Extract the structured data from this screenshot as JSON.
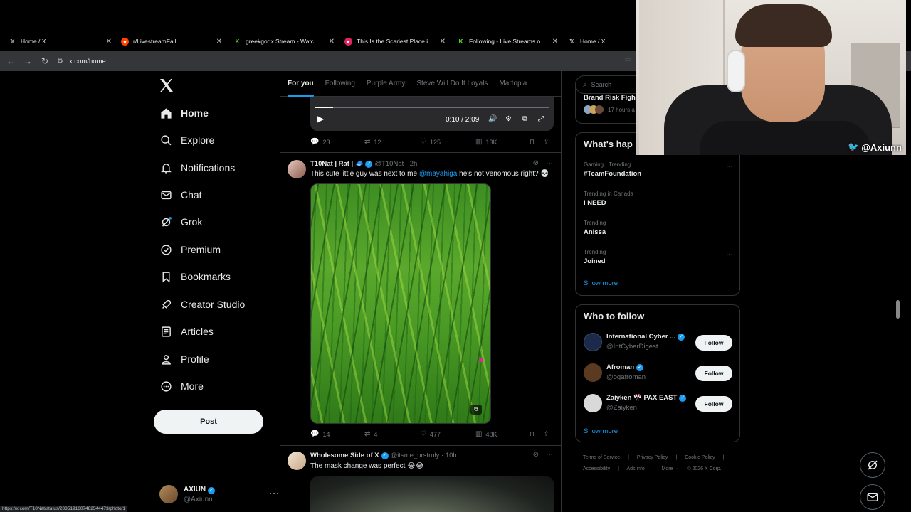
{
  "browser": {
    "tabs": [
      {
        "title": "Home / X",
        "favicon": "x-logo-icon"
      },
      {
        "title": "r/LivestreamFail",
        "favicon": "reddit-icon"
      },
      {
        "title": "greekgodx Stream - Watch Live",
        "favicon": "kick-icon"
      },
      {
        "title": "This Is the Scariest Place in The",
        "favicon": "youtube-icon"
      },
      {
        "title": "Following - Live Streams on Kic",
        "favicon": "kick-icon"
      },
      {
        "title": "Home / X",
        "favicon": "x-logo-icon"
      }
    ],
    "url": "x.com/home",
    "status_url": "https://x.com/T10Nat/status/2035191607482544473/photo/1"
  },
  "nav": {
    "items": [
      {
        "label": "Home",
        "icon": "home-icon",
        "active": true
      },
      {
        "label": "Explore",
        "icon": "search-icon"
      },
      {
        "label": "Notifications",
        "icon": "bell-icon"
      },
      {
        "label": "Chat",
        "icon": "mail-icon"
      },
      {
        "label": "Grok",
        "icon": "grok-icon"
      },
      {
        "label": "Premium",
        "icon": "premium-icon"
      },
      {
        "label": "Bookmarks",
        "icon": "bookmark-icon"
      },
      {
        "label": "Creator Studio",
        "icon": "rocket-icon"
      },
      {
        "label": "Articles",
        "icon": "article-icon"
      },
      {
        "label": "Profile",
        "icon": "person-icon"
      },
      {
        "label": "More",
        "icon": "more-circle-icon"
      }
    ],
    "post_label": "Post",
    "account": {
      "name": "AXIUN",
      "handle": "@Axiunn"
    }
  },
  "timeline": {
    "tabs": [
      "For you",
      "Following",
      "Purple Army",
      "Steve Will Do It Loyals",
      "Martopia"
    ],
    "video": {
      "time": "0:10 / 2:09",
      "progress": 0.08
    },
    "prev_stats": {
      "replies": "23",
      "reposts": "12",
      "likes": "125",
      "views": "13K"
    },
    "post1": {
      "name": "T10Nat | Rat |",
      "handle": "@T10Nat · 2h",
      "text_before": "This cute little guy was next to me ",
      "mention": "@mayahiga",
      "text_after": " he's not venomous right? 💀",
      "stats": {
        "replies": "14",
        "reposts": "4",
        "likes": "477",
        "views": "48K"
      }
    },
    "post2": {
      "name": "Wholesome Side of X",
      "handle": "@itsme_urstruly · 10h",
      "text": "The mask change was perfect 😂😂"
    }
  },
  "sidebar": {
    "search_placeholder": "Search",
    "peek_title": "Brand Risk Figh",
    "peek_time": "17 hours a",
    "trends_title": "What's hap",
    "trends": [
      {
        "context": "Gaming · Trending",
        "topic": "#TeamFoundation"
      },
      {
        "context": "Trending in Canada",
        "topic": "I NEED"
      },
      {
        "context": "Trending",
        "topic": "Anissa"
      },
      {
        "context": "Trending",
        "topic": "Joined"
      }
    ],
    "show_more": "Show more",
    "wtf_title": "Who to follow",
    "wtf": [
      {
        "name": "International Cyber ...",
        "handle": "@IntCyberDigest",
        "color": "#1b2a4a"
      },
      {
        "name": "Afroman",
        "handle": "@ogafroman",
        "color": "#5a3b22"
      },
      {
        "name": "Zaiyken 🎌 PAX EAST",
        "handle": "@Zaiyken",
        "color": "#d9d9d9"
      }
    ],
    "follow_label": "Follow",
    "footer": [
      "Terms of Service",
      "|",
      "Privacy Policy",
      "|",
      "Cookie Policy",
      "|",
      "Accessibility",
      "|",
      "Ads info",
      "|",
      "More ···",
      "© 2026 X Corp."
    ]
  },
  "webcam": {
    "tag": "@Axiunn"
  },
  "colors": {
    "accent": "#1d9bf0",
    "bg": "#000000",
    "border": "#2f3336",
    "muted": "#71767b"
  }
}
